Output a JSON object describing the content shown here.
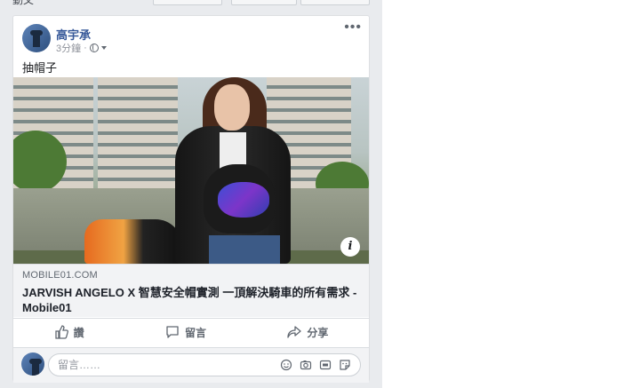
{
  "feed": {
    "top_label": "動文"
  },
  "post": {
    "author": "高宇承",
    "time": "3分鐘",
    "separator": "·",
    "text": "抽帽子",
    "link": {
      "domain": "MOBILE01.COM",
      "title": "JARVISH ANGELO X 智慧安全帽實測 一頂解決騎車的所有需求 - Mobile01",
      "info_label": "i"
    },
    "actions": {
      "like": "讚",
      "comment": "留言",
      "share": "分享"
    },
    "comment_box": {
      "placeholder": "留言……"
    }
  },
  "icons": [
    "more-options-icon",
    "globe-icon",
    "caret-down-icon",
    "info-icon",
    "thumbs-up-icon",
    "comment-icon",
    "share-icon",
    "emoji-icon",
    "camera-icon",
    "gif-icon",
    "sticker-icon"
  ],
  "colors": {
    "author_link": "#365899",
    "feed_background": "#e9ebee",
    "secondary_text": "#606770"
  }
}
